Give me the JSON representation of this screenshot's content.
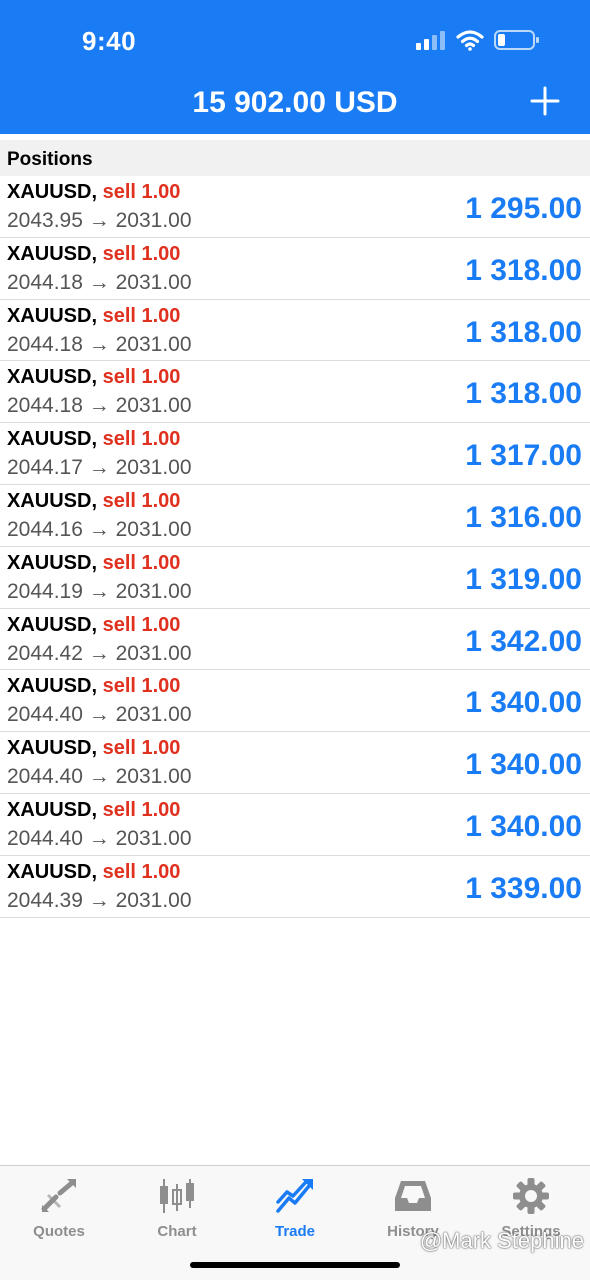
{
  "status": {
    "time": "9:40"
  },
  "header": {
    "balance": "15 902.00 USD"
  },
  "section": {
    "title": "Positions"
  },
  "positions": [
    {
      "symbol": "XAUUSD,",
      "side": "sell 1.00",
      "open": "2043.95",
      "arrow": "→",
      "current": "2031.00",
      "profit": "1 295.00"
    },
    {
      "symbol": "XAUUSD,",
      "side": "sell 1.00",
      "open": "2044.18",
      "arrow": "→",
      "current": "2031.00",
      "profit": "1 318.00"
    },
    {
      "symbol": "XAUUSD,",
      "side": "sell 1.00",
      "open": "2044.18",
      "arrow": "→",
      "current": "2031.00",
      "profit": "1 318.00"
    },
    {
      "symbol": "XAUUSD,",
      "side": "sell 1.00",
      "open": "2044.18",
      "arrow": "→",
      "current": "2031.00",
      "profit": "1 318.00"
    },
    {
      "symbol": "XAUUSD,",
      "side": "sell 1.00",
      "open": "2044.17",
      "arrow": "→",
      "current": "2031.00",
      "profit": "1 317.00"
    },
    {
      "symbol": "XAUUSD,",
      "side": "sell 1.00",
      "open": "2044.16",
      "arrow": "→",
      "current": "2031.00",
      "profit": "1 316.00"
    },
    {
      "symbol": "XAUUSD,",
      "side": "sell 1.00",
      "open": "2044.19",
      "arrow": "→",
      "current": "2031.00",
      "profit": "1 319.00"
    },
    {
      "symbol": "XAUUSD,",
      "side": "sell 1.00",
      "open": "2044.42",
      "arrow": "→",
      "current": "2031.00",
      "profit": "1 342.00"
    },
    {
      "symbol": "XAUUSD,",
      "side": "sell 1.00",
      "open": "2044.40",
      "arrow": "→",
      "current": "2031.00",
      "profit": "1 340.00"
    },
    {
      "symbol": "XAUUSD,",
      "side": "sell 1.00",
      "open": "2044.40",
      "arrow": "→",
      "current": "2031.00",
      "profit": "1 340.00"
    },
    {
      "symbol": "XAUUSD,",
      "side": "sell 1.00",
      "open": "2044.40",
      "arrow": "→",
      "current": "2031.00",
      "profit": "1 340.00"
    },
    {
      "symbol": "XAUUSD,",
      "side": "sell 1.00",
      "open": "2044.39",
      "arrow": "→",
      "current": "2031.00",
      "profit": "1 339.00"
    }
  ],
  "tabs": [
    {
      "label": "Quotes",
      "icon": "quotes-arrows-icon"
    },
    {
      "label": "Chart",
      "icon": "candlestick-icon"
    },
    {
      "label": "Trade",
      "icon": "trend-up-icon",
      "active": true
    },
    {
      "label": "History",
      "icon": "inbox-tray-icon"
    },
    {
      "label": "Settings",
      "icon": "gear-icon"
    }
  ],
  "watermark": "@Mark Stephine",
  "colors": {
    "accent": "#1a7cf5",
    "sell": "#e0301e",
    "tab_inactive": "#8e8e8e"
  }
}
